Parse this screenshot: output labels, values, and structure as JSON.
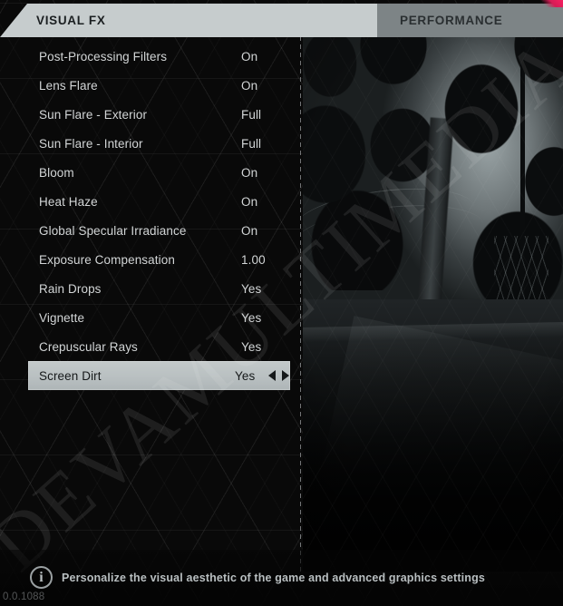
{
  "app": {
    "version_label": "0.0.1088",
    "watermark": "DEVAMULTIMEDIA"
  },
  "tabs": [
    {
      "id": "visual-fx",
      "label": "VISUAL FX",
      "active": true
    },
    {
      "id": "performance",
      "label": "PERFORMANCE",
      "active": false
    }
  ],
  "settings": {
    "rows": [
      {
        "label": "Post-Processing Filters",
        "value": "On",
        "selected": false
      },
      {
        "label": "Lens Flare",
        "value": "On",
        "selected": false
      },
      {
        "label": "Sun Flare - Exterior",
        "value": "Full",
        "selected": false
      },
      {
        "label": "Sun Flare - Interior",
        "value": "Full",
        "selected": false
      },
      {
        "label": "Bloom",
        "value": "On",
        "selected": false
      },
      {
        "label": "Heat Haze",
        "value": "On",
        "selected": false
      },
      {
        "label": "Global Specular Irradiance",
        "value": "On",
        "selected": false
      },
      {
        "label": "Exposure Compensation",
        "value": "1.00",
        "selected": false
      },
      {
        "label": "Rain Drops",
        "value": "Yes",
        "selected": false
      },
      {
        "label": "Vignette",
        "value": "Yes",
        "selected": false
      },
      {
        "label": "Crepuscular Rays",
        "value": "Yes",
        "selected": false
      },
      {
        "label": "Screen Dirt",
        "value": "Yes",
        "selected": true
      }
    ]
  },
  "footer": {
    "description": "Personalize the visual aesthetic of the game and advanced graphics settings",
    "info_glyph": "i"
  },
  "colors": {
    "tab_active_bg": "#c6cccd",
    "tab_inactive_bg": "#7d8486",
    "accent_pink": "#ff2266",
    "row_selected_bg": "#bcc2c4",
    "text_light": "#d2d5d6",
    "text_dark": "#16191a"
  }
}
